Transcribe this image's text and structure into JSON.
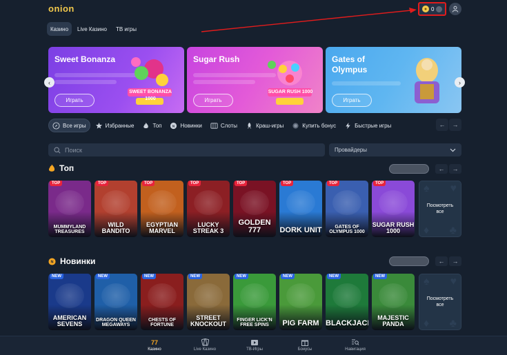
{
  "header": {
    "logo": "onion",
    "balance": "0"
  },
  "tabs": [
    "Казино",
    "Live Казино",
    "ТВ игры"
  ],
  "banners": [
    {
      "title": "Sweet Bonanza",
      "button": "Играть",
      "art_label": "SWEET BONANZA 1000",
      "color": "#8b47ea"
    },
    {
      "title": "Sugar Rush",
      "button": "Играть",
      "art_label": "SUGAR RUSH 1000",
      "color": "#dc53da"
    },
    {
      "title": "Gates of Olympus",
      "button": "Играть",
      "art_label": "",
      "color": "#5ab2ef"
    }
  ],
  "categories": [
    {
      "label": "Все игры",
      "icon": "compass-icon"
    },
    {
      "label": "Избранные",
      "icon": "star-icon"
    },
    {
      "label": "Топ",
      "icon": "flame-icon"
    },
    {
      "label": "Новинки",
      "icon": "new-icon"
    },
    {
      "label": "Слоты",
      "icon": "slot-icon"
    },
    {
      "label": "Краш-игры",
      "icon": "rocket-icon"
    },
    {
      "label": "Купить бонус",
      "icon": "bonus-icon"
    },
    {
      "label": "Быстрые игры",
      "icon": "lightning-icon"
    }
  ],
  "search": {
    "placeholder": "Поиск"
  },
  "providers": {
    "label": "Провайдеры"
  },
  "sections": [
    {
      "title": "Топ",
      "icon": "flame-icon",
      "more_label": "Посмотреть все",
      "games": [
        {
          "badge": "TOP",
          "title": "MUMMYLAND TREASURES",
          "color": "#7a2a8a"
        },
        {
          "badge": "TOP",
          "title": "WILD BANDITO",
          "color": "#b2402f"
        },
        {
          "badge": "TOP",
          "title": "EGYPTIAN MARVEL",
          "color": "#c2601e"
        },
        {
          "badge": "TOP",
          "title": "LUCKY STREAK 3",
          "color": "#8c1f24"
        },
        {
          "badge": "TOP",
          "title": "GOLDEN 777",
          "color": "#7a1224"
        },
        {
          "badge": "TOP",
          "title": "DORK UNIT",
          "color": "#2a7ad4"
        },
        {
          "badge": "TOP",
          "title": "GATES OF OLYMPUS 1000",
          "color": "#3a5fb0"
        },
        {
          "badge": "TOP",
          "title": "SUGAR RUSH 1000",
          "color": "#8a4ad8"
        }
      ]
    },
    {
      "title": "Новинки",
      "icon": "new-icon",
      "more_label": "Посмотреть все",
      "games": [
        {
          "badge": "NEW",
          "title": "AMERICAN SEVENS",
          "color": "#1a3a8a"
        },
        {
          "badge": "NEW",
          "title": "DRAGON QUEEN MEGAWAYS",
          "color": "#1f5fa8"
        },
        {
          "badge": "NEW",
          "title": "CHESTS OF FORTUNE",
          "color": "#8a1e1e"
        },
        {
          "badge": "NEW",
          "title": "STREET KNOCKOUT",
          "color": "#8a6a3a"
        },
        {
          "badge": "NEW",
          "title": "FINGER LICK'N FREE SPINS",
          "color": "#3a9a3a"
        },
        {
          "badge": "NEW",
          "title": "PIG FARM",
          "color": "#4a9a3a"
        },
        {
          "badge": "NEW",
          "title": "BLACKJACK",
          "color": "#1e7a3a"
        },
        {
          "badge": "NEW",
          "title": "MAJESTIC PANDA",
          "color": "#3a8a3a"
        }
      ]
    }
  ],
  "bottom_nav": [
    {
      "label": "Казино",
      "icon": "casino-icon",
      "active": true
    },
    {
      "label": "Live Казино",
      "icon": "cards-icon",
      "active": false
    },
    {
      "label": "ТВ-Игры",
      "icon": "tv-icon",
      "active": false
    },
    {
      "label": "Бонусы",
      "icon": "gift-icon",
      "active": false
    },
    {
      "label": "Навигация",
      "icon": "search-list-icon",
      "active": false
    }
  ]
}
